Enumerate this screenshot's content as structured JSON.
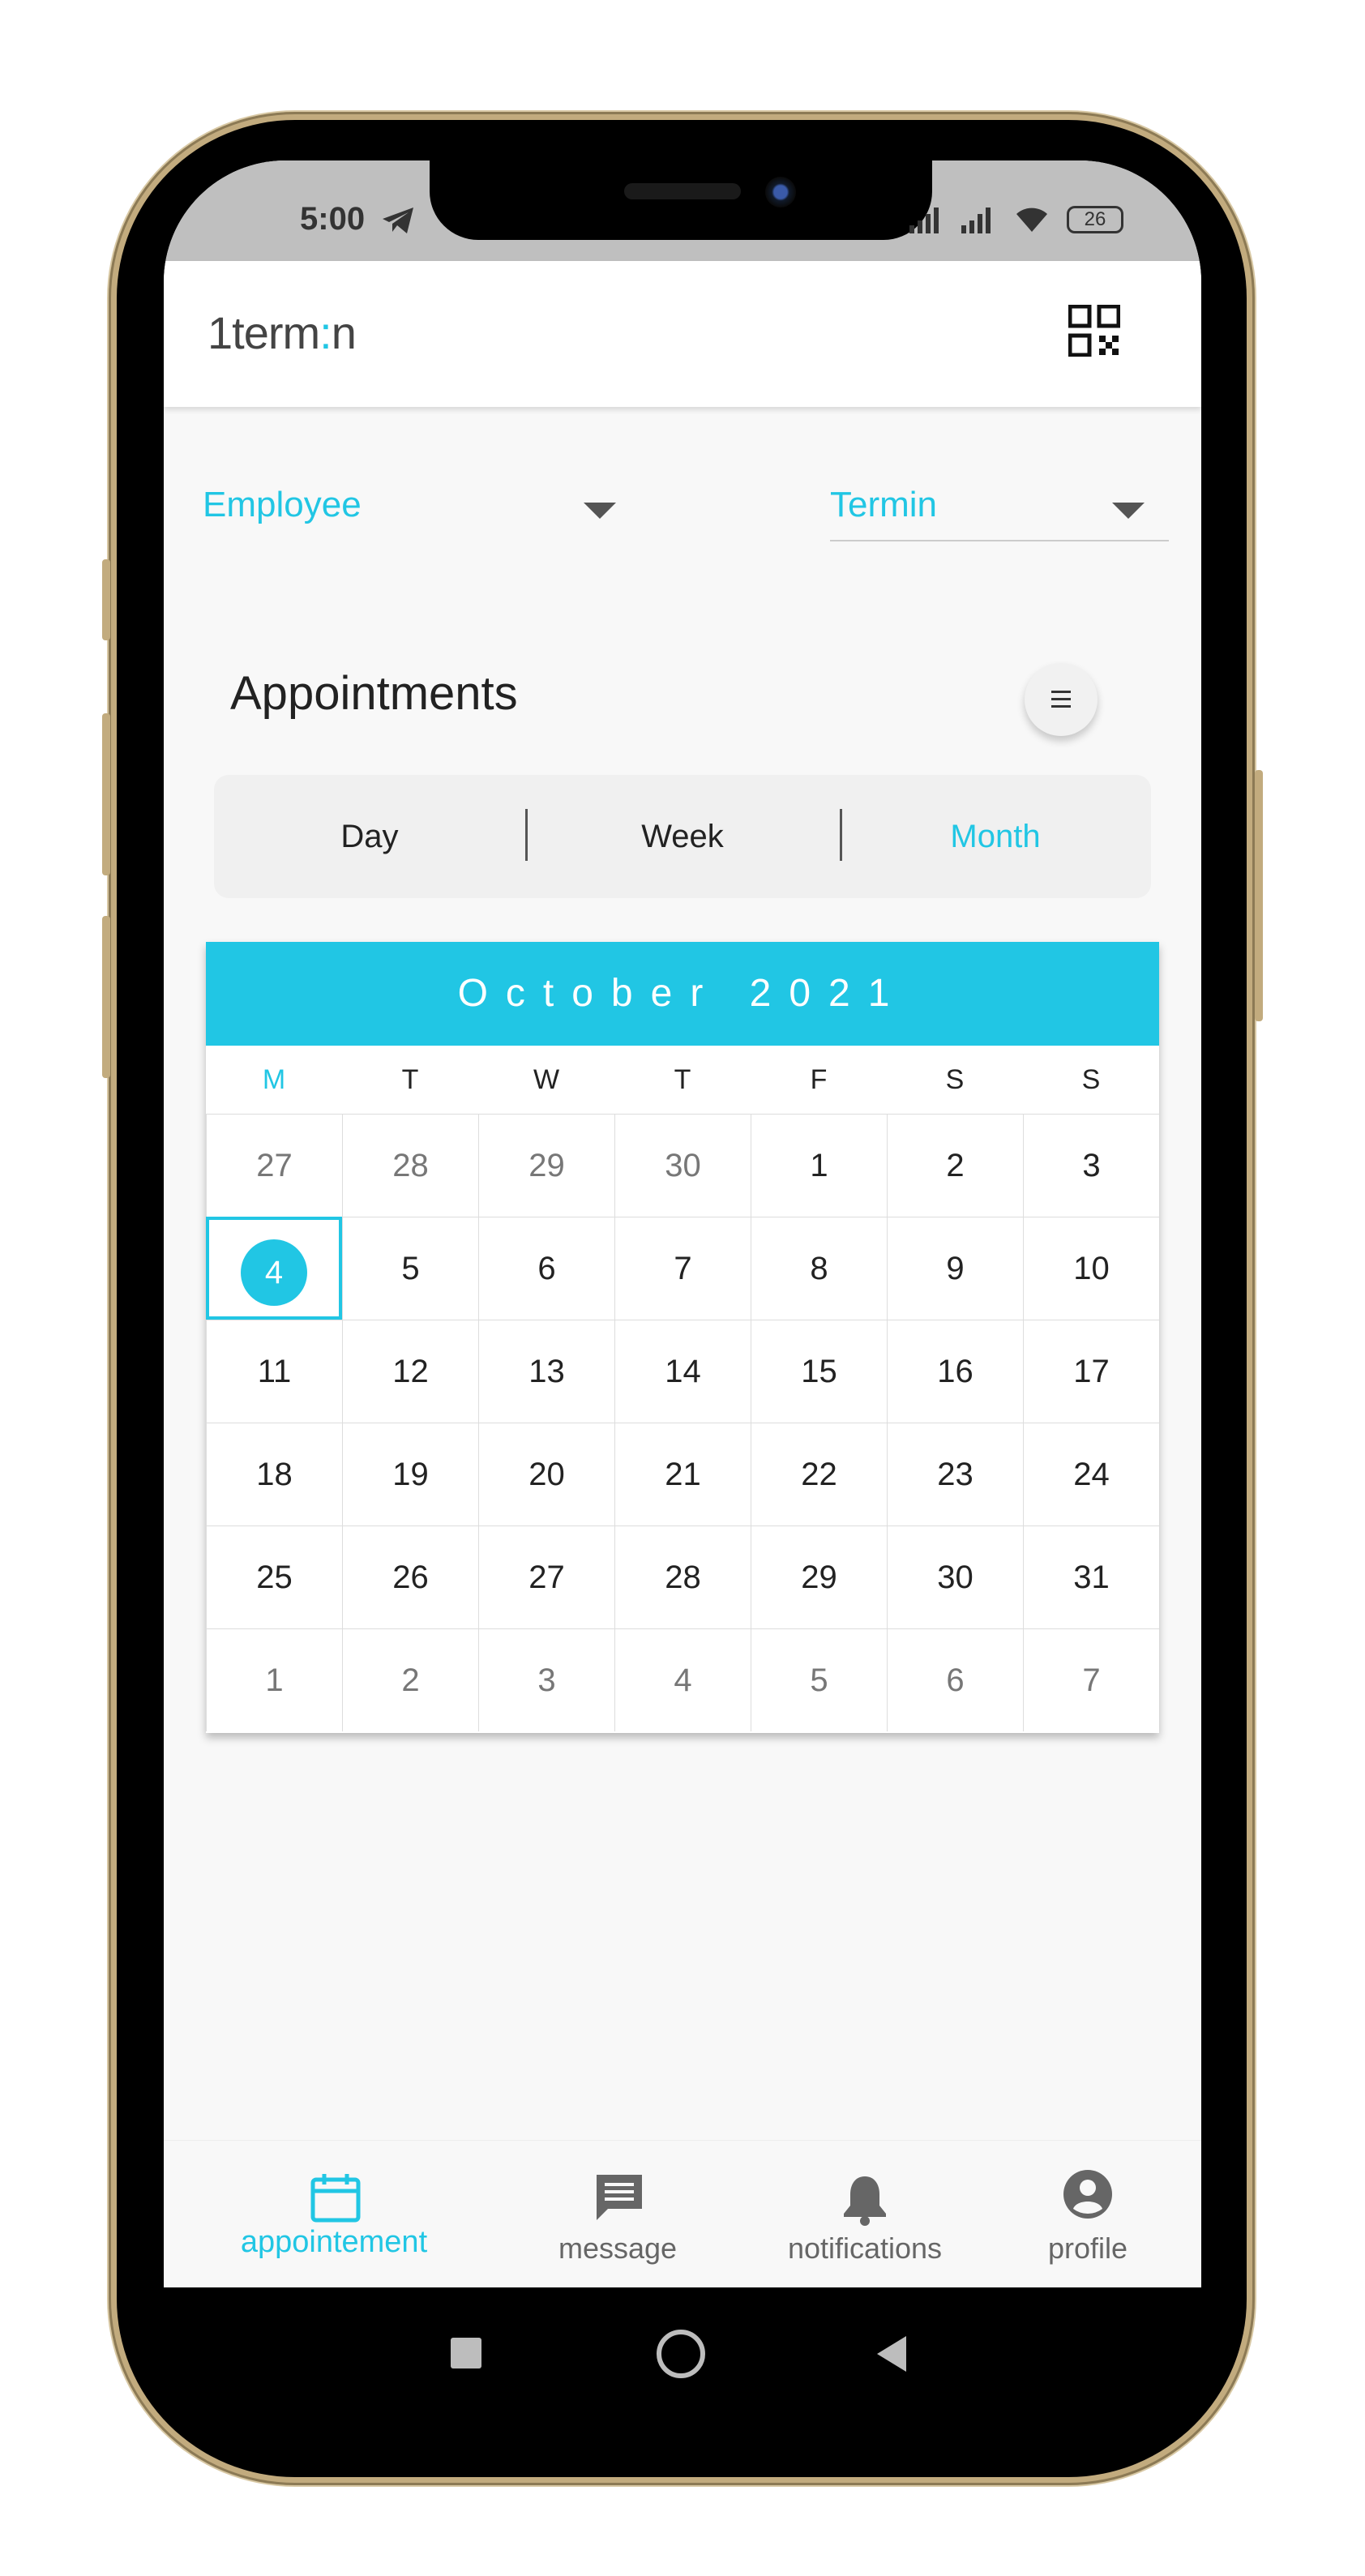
{
  "status_bar": {
    "time": "5:00",
    "battery": "26"
  },
  "app": {
    "logo": "1term:n",
    "logo_left": "1term",
    "logo_dot": ":",
    "logo_right": "n"
  },
  "filters": {
    "employee_label": "Employee",
    "termin_label": "Termin"
  },
  "appointments": {
    "title": "Appointments",
    "views": [
      "Day",
      "Week",
      "Month"
    ],
    "active_view": "Month"
  },
  "calendar": {
    "month_title": "October 2021",
    "weekdays": [
      "M",
      "T",
      "W",
      "T",
      "F",
      "S",
      "S"
    ],
    "active_weekday_index": 0,
    "selected_day": "4",
    "weeks": [
      [
        "27",
        "28",
        "29",
        "30",
        "1",
        "2",
        "3"
      ],
      [
        "4",
        "5",
        "6",
        "7",
        "8",
        "9",
        "10"
      ],
      [
        "11",
        "12",
        "13",
        "14",
        "15",
        "16",
        "17"
      ],
      [
        "18",
        "19",
        "20",
        "21",
        "22",
        "23",
        "24"
      ],
      [
        "25",
        "26",
        "27",
        "28",
        "29",
        "30",
        "31"
      ],
      [
        "1",
        "2",
        "3",
        "4",
        "5",
        "6",
        "7"
      ]
    ]
  },
  "bottom_nav": [
    {
      "label": "appointement",
      "icon": "calendar-icon",
      "active": true
    },
    {
      "label": "message",
      "icon": "message-icon",
      "active": false
    },
    {
      "label": "notifications",
      "icon": "bell-icon",
      "active": false
    },
    {
      "label": "profile",
      "icon": "profile-icon",
      "active": false
    }
  ],
  "colors": {
    "accent": "#21c6e4",
    "text": "#222222",
    "muted": "#777777",
    "frame": "#c2ab7e"
  }
}
